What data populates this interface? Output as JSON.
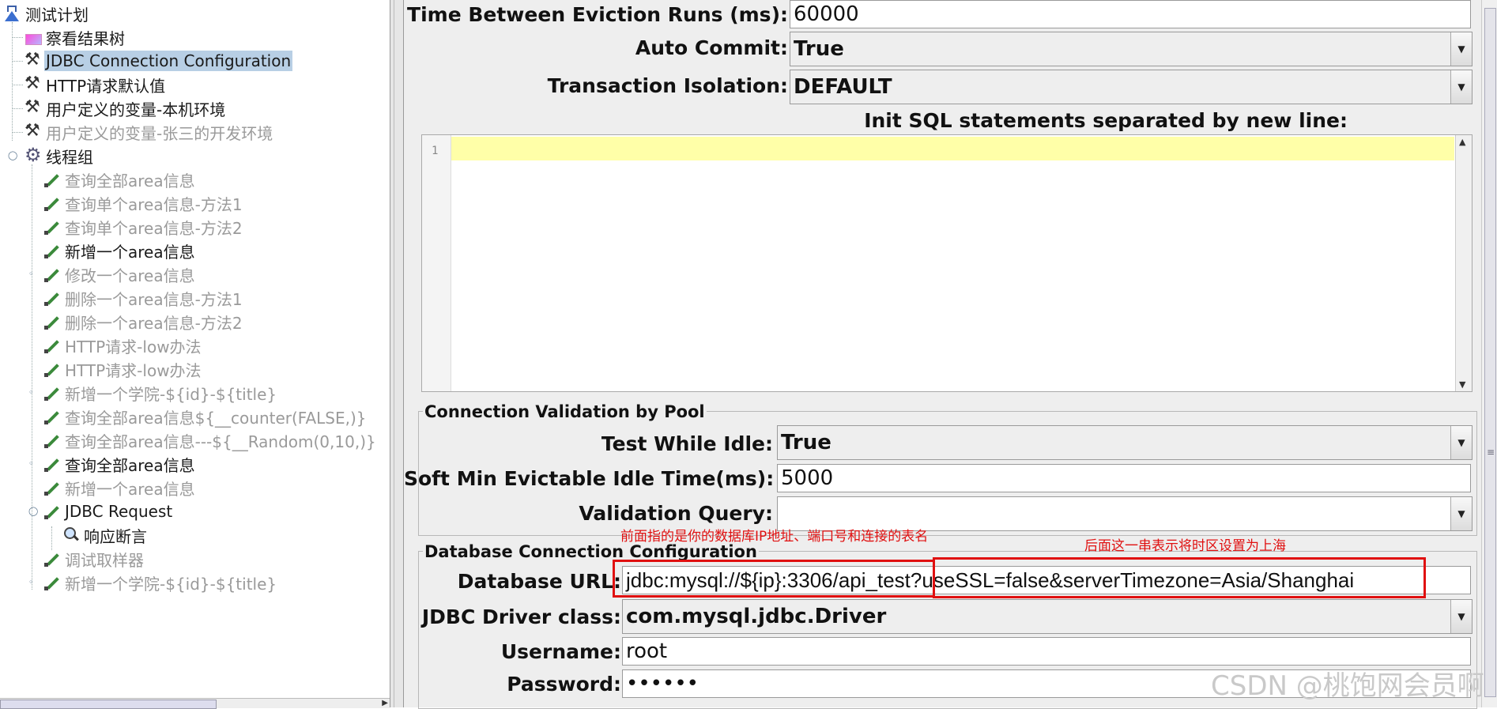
{
  "tree": {
    "items": [
      {
        "label": "测试计划",
        "icon": "flask-icon",
        "disabled": false,
        "selected": false
      },
      {
        "label": "察看结果树",
        "icon": "chart-icon",
        "disabled": false,
        "selected": false
      },
      {
        "label": "JDBC Connection Configuration",
        "icon": "tool-icon",
        "disabled": false,
        "selected": true
      },
      {
        "label": "HTTP请求默认值",
        "icon": "tool-icon",
        "disabled": false,
        "selected": false
      },
      {
        "label": "用户定义的变量-本机环境",
        "icon": "tool-icon",
        "disabled": false,
        "selected": false
      },
      {
        "label": "用户定义的变量-张三的开发环境",
        "icon": "tool-icon",
        "disabled": true,
        "selected": false
      },
      {
        "label": "线程组",
        "icon": "gear-icon",
        "disabled": false,
        "selected": false
      },
      {
        "label": "查询全部area信息",
        "icon": "pen-icon",
        "disabled": true,
        "selected": false
      },
      {
        "label": "查询单个area信息-方法1",
        "icon": "pen-icon",
        "disabled": true,
        "selected": false
      },
      {
        "label": "查询单个area信息-方法2",
        "icon": "pen-icon",
        "disabled": true,
        "selected": false
      },
      {
        "label": "新增一个area信息",
        "icon": "pen-icon",
        "disabled": false,
        "selected": false
      },
      {
        "label": "修改一个area信息",
        "icon": "pen-icon",
        "disabled": true,
        "selected": false
      },
      {
        "label": "删除一个area信息-方法1",
        "icon": "pen-icon",
        "disabled": true,
        "selected": false
      },
      {
        "label": "删除一个area信息-方法2",
        "icon": "pen-icon",
        "disabled": true,
        "selected": false
      },
      {
        "label": "HTTP请求-low办法",
        "icon": "pen-icon",
        "disabled": true,
        "selected": false
      },
      {
        "label": "HTTP请求-low办法",
        "icon": "pen-icon",
        "disabled": true,
        "selected": false
      },
      {
        "label": "新增一个学院-${id}-${title}",
        "icon": "pen-icon",
        "disabled": true,
        "selected": false
      },
      {
        "label": "查询全部area信息${__counter(FALSE,)}",
        "icon": "pen-icon",
        "disabled": true,
        "selected": false
      },
      {
        "label": "查询全部area信息---${__Random(0,10,)}",
        "icon": "pen-icon",
        "disabled": true,
        "selected": false
      },
      {
        "label": "查询全部area信息",
        "icon": "pen-icon",
        "disabled": false,
        "selected": false
      },
      {
        "label": "新增一个area信息",
        "icon": "pen-icon",
        "disabled": true,
        "selected": false
      },
      {
        "label": "JDBC Request",
        "icon": "pen-icon",
        "disabled": false,
        "selected": false
      },
      {
        "label": "响应断言",
        "icon": "magnifier-icon",
        "disabled": false,
        "selected": false
      },
      {
        "label": "调试取样器",
        "icon": "pen-icon",
        "disabled": true,
        "selected": false
      },
      {
        "label": "新增一个学院-${id}-${title}",
        "icon": "pen-icon",
        "disabled": true,
        "selected": false
      }
    ]
  },
  "config": {
    "eviction_label": "Time Between Eviction Runs (ms):",
    "eviction_value": "60000",
    "auto_commit_label": "Auto Commit:",
    "auto_commit_value": "True",
    "isolation_label": "Transaction Isolation:",
    "isolation_value": "DEFAULT",
    "init_sql_label": "Init SQL statements separated by new line:",
    "init_sql_line_number": "1",
    "validation_section": "Connection Validation by Pool",
    "test_idle_label": "Test While Idle:",
    "test_idle_value": "True",
    "soft_min_label": "Soft Min Evictable Idle Time(ms):",
    "soft_min_value": "5000",
    "validation_query_label": "Validation Query:",
    "validation_query_value": "",
    "db_section": "Database Connection Configuration",
    "db_url_label": "Database URL:",
    "db_url_value": "jdbc:mysql://${ip}:3306/api_test?useSSL=false&serverTimezone=Asia/Shanghai",
    "driver_label": "JDBC Driver class:",
    "driver_value": "com.mysql.jdbc.Driver",
    "username_label": "Username:",
    "username_value": "root",
    "password_label": "Password:",
    "password_value": "••••••"
  },
  "annotations": {
    "left_note": "前面指的是你的数据库IP地址、端口号和连接的表名",
    "right_note": "后面这一串表示将时区设置为上海",
    "color": "#e01010"
  },
  "watermark": "CSDN @桃饱网会员啊",
  "colors": {
    "selection": "#b8cfe5",
    "panel": "#eeeeee",
    "sql_current_line": "#ffffa8"
  }
}
